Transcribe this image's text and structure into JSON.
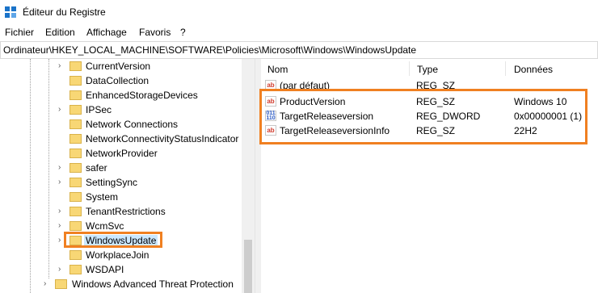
{
  "window": {
    "title": "Éditeur du Registre",
    "accent_color": "#0078d7"
  },
  "menu": [
    "Fichier",
    "Edition",
    "Affichage",
    "Favoris",
    "?"
  ],
  "address": "Ordinateur\\HKEY_LOCAL_MACHINE\\SOFTWARE\\Policies\\Microsoft\\Windows\\WindowsUpdate",
  "tree": {
    "items": [
      "CurrentVersion",
      "DataCollection",
      "EnhancedStorageDevices",
      "IPSec",
      "Network Connections",
      "NetworkConnectivityStatusIndicator",
      "NetworkProvider",
      "safer",
      "SettingSync",
      "System",
      "TenantRestrictions",
      "WcmSvc",
      "WindowsUpdate",
      "WorkplaceJoin",
      "WSDAPI",
      "Windows Advanced Threat Protection"
    ],
    "selected": "WindowsUpdate"
  },
  "list": {
    "columns": [
      "Nom",
      "Type",
      "Données"
    ],
    "rows": [
      {
        "name": "(par défaut)",
        "type": "REG_SZ",
        "data": "",
        "icon": "ab-string-icon"
      },
      {
        "name": "ProductVersion",
        "type": "REG_SZ",
        "data": "Windows 10",
        "icon": "ab-string-icon"
      },
      {
        "name": "TargetReleaseversion",
        "type": "REG_DWORD",
        "data": "0x00000001 (1)",
        "icon": "binary-dword-icon"
      },
      {
        "name": "TargetReleaseversionInfo",
        "type": "REG_SZ",
        "data": "22H2",
        "icon": "ab-string-icon"
      }
    ]
  },
  "highlight_color": "#f08021"
}
